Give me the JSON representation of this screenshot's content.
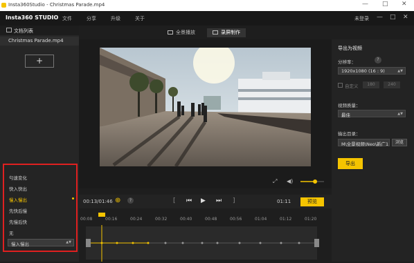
{
  "window": {
    "title": "Insta360Studio - Christmas Parade.mp4",
    "minimize": "—",
    "maximize": "□",
    "close": "✕"
  },
  "menubar": {
    "brand": "Insta360 STUDIO",
    "items": [
      "文件",
      "分享",
      "升级",
      "关于"
    ],
    "login": "未登录",
    "win_min": "—",
    "win_max": "□",
    "win_close": "✕"
  },
  "sidebar": {
    "header": "文档列表",
    "file": "Christmas Parade.mp4",
    "add": "+"
  },
  "transitions": {
    "options": [
      "勻速变化",
      "快入快出",
      "慢入慢出",
      "先快后慢",
      "先慢后快",
      "无"
    ],
    "selected_index": 2,
    "select_value": "慢入慢出"
  },
  "modes": {
    "panorama": "全景播放",
    "export": "录屏制作"
  },
  "player": {
    "time_current": "00:13/01:46",
    "time_end": "01:11",
    "help": "?",
    "preview_btn": "预览",
    "volume": 0.62
  },
  "ruler": [
    "00:08",
    "00:16",
    "00:24",
    "00:32",
    "00:40",
    "00:48",
    "00:56",
    "01:04",
    "01:12",
    "01:20"
  ],
  "right": {
    "title": "导出为视频",
    "resolution_label": "分辨率：",
    "help": "?",
    "resolution_value": "1920x1080 (16 : 9)",
    "custom_label": "自定义",
    "custom_w": "180",
    "custom_h": "240",
    "quality_label": "视频质量：",
    "quality_value": "最佳",
    "dir_label": "输出目录：",
    "dir_value": "M\\全景视频\\Neo\\新广1",
    "browse": "浏览",
    "export": "导出"
  }
}
